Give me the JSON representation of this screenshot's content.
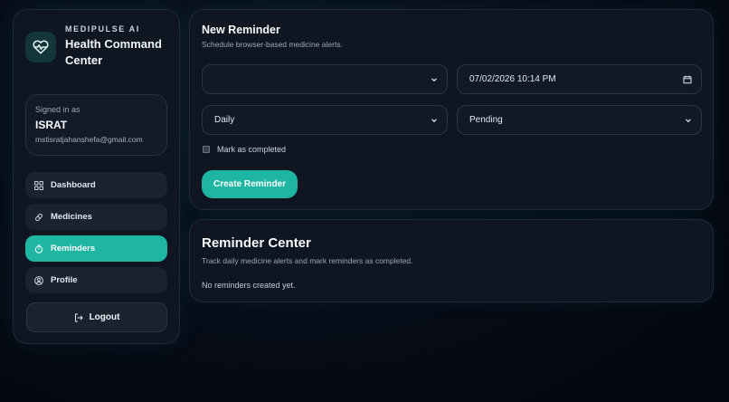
{
  "brand": {
    "kicker": "MEDIPULSE AI",
    "title_line1": "Health Command",
    "title_line2": "Center",
    "icon": "heart-pulse-icon"
  },
  "user": {
    "signed_in_label": "Signed in as",
    "name": "ISRAT",
    "email": "mstisratjahanshefa@gmail.com"
  },
  "nav": {
    "items": [
      {
        "label": "Dashboard",
        "icon": "grid-icon",
        "active": false
      },
      {
        "label": "Medicines",
        "icon": "pill-icon",
        "active": false
      },
      {
        "label": "Reminders",
        "icon": "alarm-icon",
        "active": true
      },
      {
        "label": "Profile",
        "icon": "user-circle-icon",
        "active": false
      }
    ],
    "logout_label": "Logout"
  },
  "new_reminder": {
    "title": "New Reminder",
    "subtitle": "Schedule browser-based medicine alerts.",
    "medicine_select_value": "",
    "datetime_value": "07/02/2026 10:14 PM",
    "frequency_value": "Daily",
    "status_value": "Pending",
    "completed_label": "Mark as completed",
    "completed_checked": false,
    "create_label": "Create Reminder"
  },
  "reminder_center": {
    "title": "Reminder Center",
    "subtitle": "Track daily medicine alerts and mark reminders as completed.",
    "empty_text": "No reminders created yet."
  },
  "colors": {
    "accent": "#1fb5a3",
    "background": "#050913",
    "panel": "#0f1622"
  }
}
